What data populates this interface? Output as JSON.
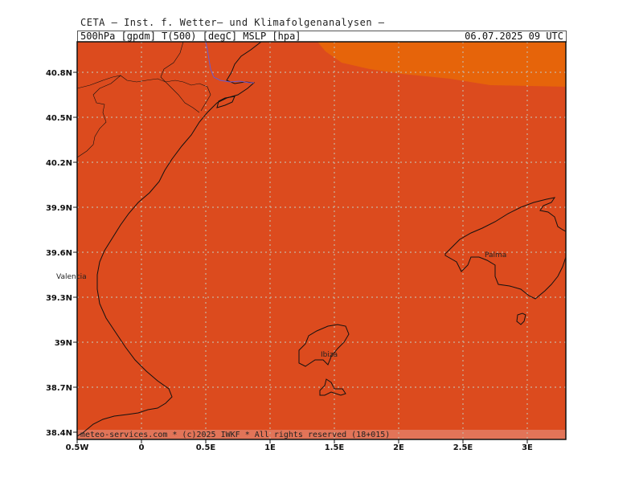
{
  "header": {
    "title": "CETA — Inst. f. Wetter— und Klimafolgenanalysen —",
    "params": "500hPa_[gpdm]_T(500)_[degC]_MSLP_[hpa]",
    "valid_time": "06.07.2025  09 UTC"
  },
  "colors": {
    "background_field": "#dc4b1e",
    "warm_field": "#e6640a",
    "coast": "#111111",
    "grid": "#c8b4a0",
    "footer_band": "#e27458"
  },
  "axes": {
    "y_labels": [
      "40.8N",
      "40.5N",
      "40.2N",
      "39.9N",
      "39.6N",
      "39.3N",
      "39N",
      "38.7N",
      "38.4N"
    ],
    "x_labels": [
      "0.5W",
      "0",
      "0.5E",
      "1E",
      "1.5E",
      "2E",
      "2.5E",
      "3E"
    ]
  },
  "cities": {
    "valencia": "Valencia",
    "palma": "Palma",
    "ibiza": "Ibiza"
  },
  "footer": {
    "copyright": "meteo-services.com * (c)2025 IWKF * All rights reserved (18+015)"
  }
}
